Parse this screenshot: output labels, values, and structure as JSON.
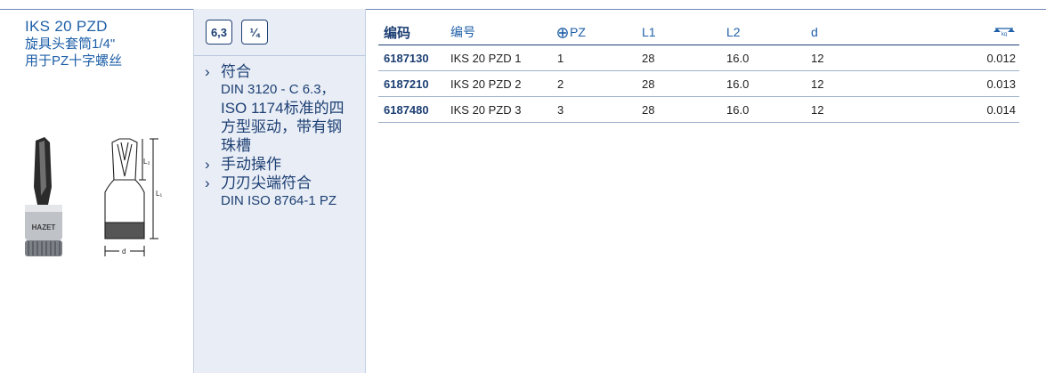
{
  "product": {
    "title": "IKS 20 PZD",
    "subtitle_line1": "旋具头套筒1/4\"",
    "subtitle_line2": "用于PZ十字螺丝",
    "image_brand": "HAZET",
    "dim_labels": {
      "l1": "L₁",
      "l2": "L₂",
      "d": "d"
    }
  },
  "badges": [
    "6,3",
    "¼"
  ],
  "features": [
    {
      "head": "符合",
      "lines": [
        "DIN 3120 - C 6.3，",
        "ISO 1174标准的四"
      ],
      "big_lines": [
        "方型驱动，带有钢",
        "珠槽"
      ]
    },
    {
      "head": "手动操作",
      "lines": [],
      "big_lines": []
    },
    {
      "head": "刀刃尖端符合",
      "lines": [
        "DIN ISO 8764-1 PZ"
      ],
      "big_lines": []
    }
  ],
  "table": {
    "headers": {
      "code": "编码",
      "number": "编号",
      "pz": "PZ",
      "l1": "L1",
      "l2": "L2",
      "d": "d",
      "weight_icon": "scale-kg-icon",
      "weight_unit": "kg"
    },
    "rows": [
      {
        "code": "6187130",
        "number": "IKS 20 PZD 1",
        "pz": "1",
        "l1": "28",
        "l2": "16.0",
        "d": "12",
        "weight": "0.012"
      },
      {
        "code": "6187210",
        "number": "IKS 20 PZD 2",
        "pz": "2",
        "l1": "28",
        "l2": "16.0",
        "d": "12",
        "weight": "0.013"
      },
      {
        "code": "6187480",
        "number": "IKS 20 PZD 3",
        "pz": "3",
        "l1": "28",
        "l2": "16.0",
        "d": "12",
        "weight": "0.014"
      }
    ]
  },
  "colors": {
    "navy": "#1d3f73",
    "accent_blue": "#1e5fa8",
    "panel_bg": "#e9eef6"
  }
}
